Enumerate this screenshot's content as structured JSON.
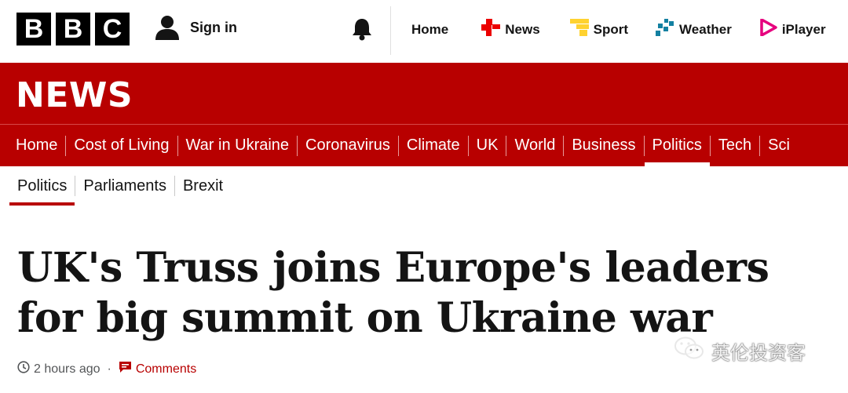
{
  "global_header": {
    "logo_letters": [
      "B",
      "B",
      "C"
    ],
    "sign_in_label": "Sign in",
    "nav": [
      {
        "label": "Home",
        "icon": "none"
      },
      {
        "label": "News",
        "icon": "news-icon",
        "color": "#eb0000"
      },
      {
        "label": "Sport",
        "icon": "sport-icon",
        "color": "#ffd230"
      },
      {
        "label": "Weather",
        "icon": "weather-icon",
        "color": "#1380a1"
      },
      {
        "label": "iPlayer",
        "icon": "iplayer-icon",
        "color": "#e6007e"
      }
    ]
  },
  "banner": {
    "title": "NEWS",
    "color": "#b80000"
  },
  "section_nav": {
    "items": [
      "Home",
      "Cost of Living",
      "War in Ukraine",
      "Coronavirus",
      "Climate",
      "UK",
      "World",
      "Business",
      "Politics",
      "Tech",
      "Sci"
    ],
    "active": "Politics"
  },
  "sub_nav": {
    "items": [
      "Politics",
      "Parliaments",
      "Brexit"
    ],
    "active": "Politics"
  },
  "article": {
    "headline": "UK's Truss joins Europe's leaders for big summit on Ukraine war",
    "timestamp": "2 hours ago",
    "separator": "·",
    "comments_label": "Comments"
  },
  "watermark": {
    "text": "英伦投资客",
    "icon": "wechat-icon"
  }
}
